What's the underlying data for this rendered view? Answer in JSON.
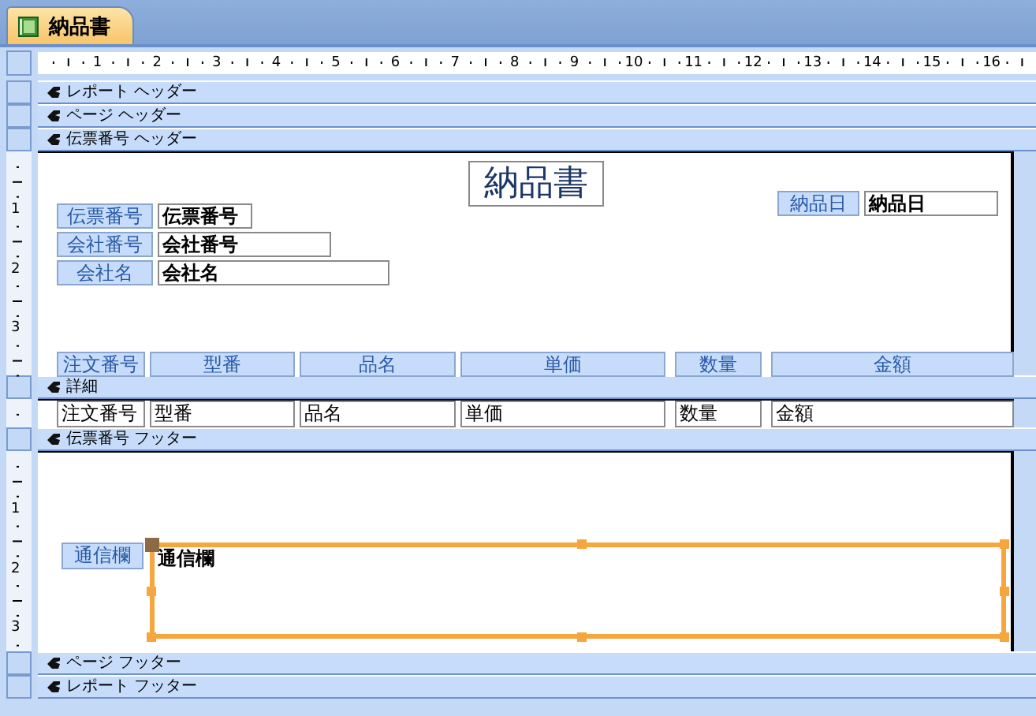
{
  "document_tab": {
    "title": "納品書",
    "selected": true
  },
  "horizontal_ruler": [
    "1",
    "2",
    "3",
    "4",
    "5",
    "6",
    "7",
    "8",
    "9",
    "10",
    "11",
    "12",
    "13",
    "14",
    "15",
    "16"
  ],
  "sections": [
    {
      "title": "レポート ヘッダー"
    },
    {
      "title": "ページ ヘッダー"
    },
    {
      "title": "伝票番号 ヘッダー",
      "vertical_ruler": [
        "1",
        "2",
        "3"
      ],
      "controls": [
        {
          "kind": "title",
          "text": "納品書",
          "selected": false
        },
        {
          "kind": "label",
          "text": "伝票番号",
          "selected": false
        },
        {
          "kind": "textbox",
          "text": "伝票番号",
          "bold": true,
          "selected": false
        },
        {
          "kind": "label",
          "text": "納品日",
          "selected": false
        },
        {
          "kind": "textbox",
          "text": "納品日",
          "bold": true,
          "selected": false
        },
        {
          "kind": "label",
          "text": "会社番号",
          "selected": false
        },
        {
          "kind": "textbox",
          "text": "会社番号",
          "bold": true,
          "selected": false
        },
        {
          "kind": "label",
          "text": "会社名",
          "selected": false
        },
        {
          "kind": "textbox",
          "text": "会社名",
          "bold": true,
          "selected": false
        },
        {
          "kind": "label",
          "text": "注文番号",
          "selected": false
        },
        {
          "kind": "label",
          "text": "型番",
          "selected": false
        },
        {
          "kind": "label",
          "text": "品名",
          "selected": false
        },
        {
          "kind": "label",
          "text": "単価",
          "selected": false
        },
        {
          "kind": "label",
          "text": "数量",
          "selected": false
        },
        {
          "kind": "label",
          "text": "金額",
          "selected": false
        }
      ]
    },
    {
      "title": "詳細",
      "controls": [
        {
          "kind": "textbox",
          "text": "注文番号",
          "bold": false,
          "selected": false
        },
        {
          "kind": "textbox",
          "text": "型番",
          "bold": false,
          "selected": false
        },
        {
          "kind": "textbox",
          "text": "品名",
          "bold": false,
          "selected": false
        },
        {
          "kind": "textbox",
          "text": "単価",
          "bold": false,
          "selected": false
        },
        {
          "kind": "textbox",
          "text": "数量",
          "bold": false,
          "selected": false
        },
        {
          "kind": "textbox",
          "text": "金額",
          "bold": false,
          "selected": false
        }
      ]
    },
    {
      "title": "伝票番号 フッター",
      "vertical_ruler": [
        "1",
        "2",
        "3"
      ],
      "controls": [
        {
          "kind": "label",
          "text": "通信欄",
          "selected": false
        },
        {
          "kind": "textbox",
          "text": "通信欄",
          "bold": true,
          "selected": true
        }
      ]
    },
    {
      "title": "ページ フッター"
    },
    {
      "title": "レポート フッター"
    }
  ]
}
